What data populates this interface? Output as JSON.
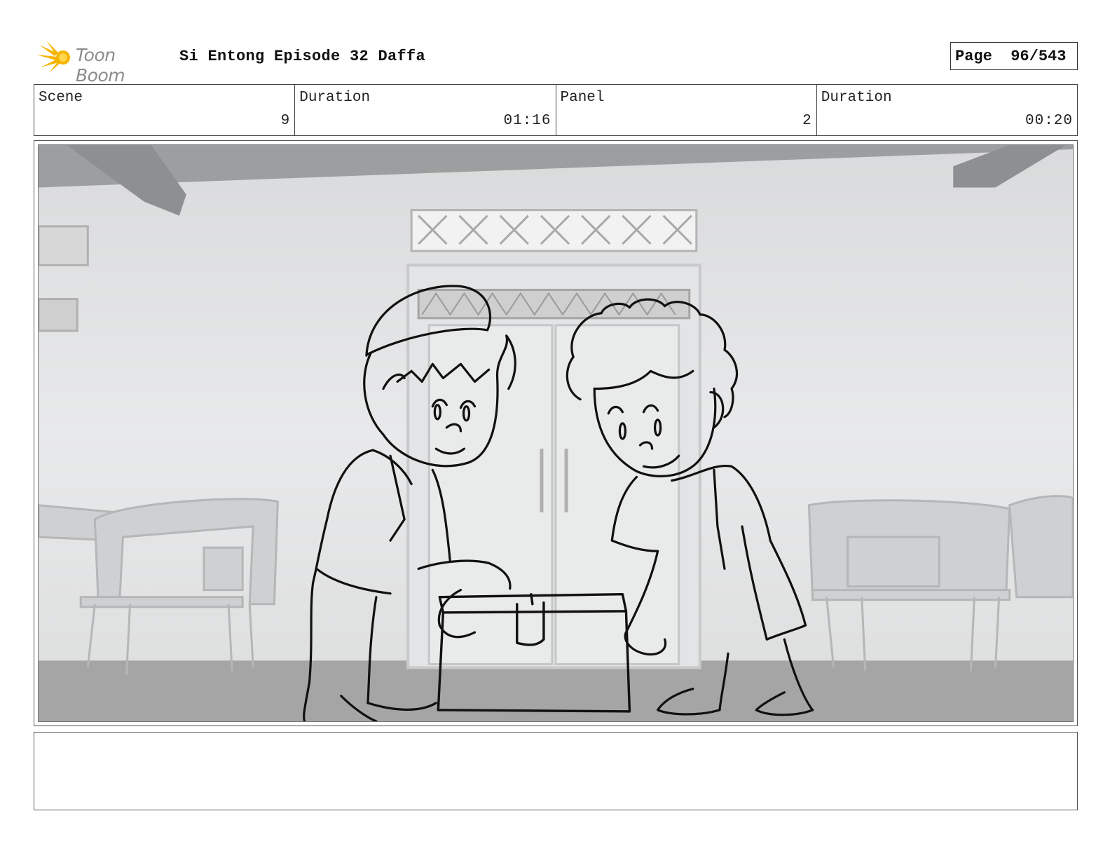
{
  "header": {
    "logo_text": "Toon Boom",
    "title": "Si Entong Episode 32 Daffa",
    "page_label": "Page",
    "page_value": "96/543"
  },
  "info": {
    "scene_label": "Scene",
    "scene_value": "9",
    "scene_duration_label": "Duration",
    "scene_duration_value": "01:16",
    "panel_label": "Panel",
    "panel_value": "2",
    "panel_duration_label": "Duration",
    "panel_duration_value": "00:20"
  },
  "notes": {
    "text": ""
  },
  "colors": {
    "logo_flare": "#f5b400",
    "logo_text": "#8c8c8c",
    "border": "#444444",
    "background_wall": "#e6e7e8",
    "floor": "#a5a5a5"
  }
}
